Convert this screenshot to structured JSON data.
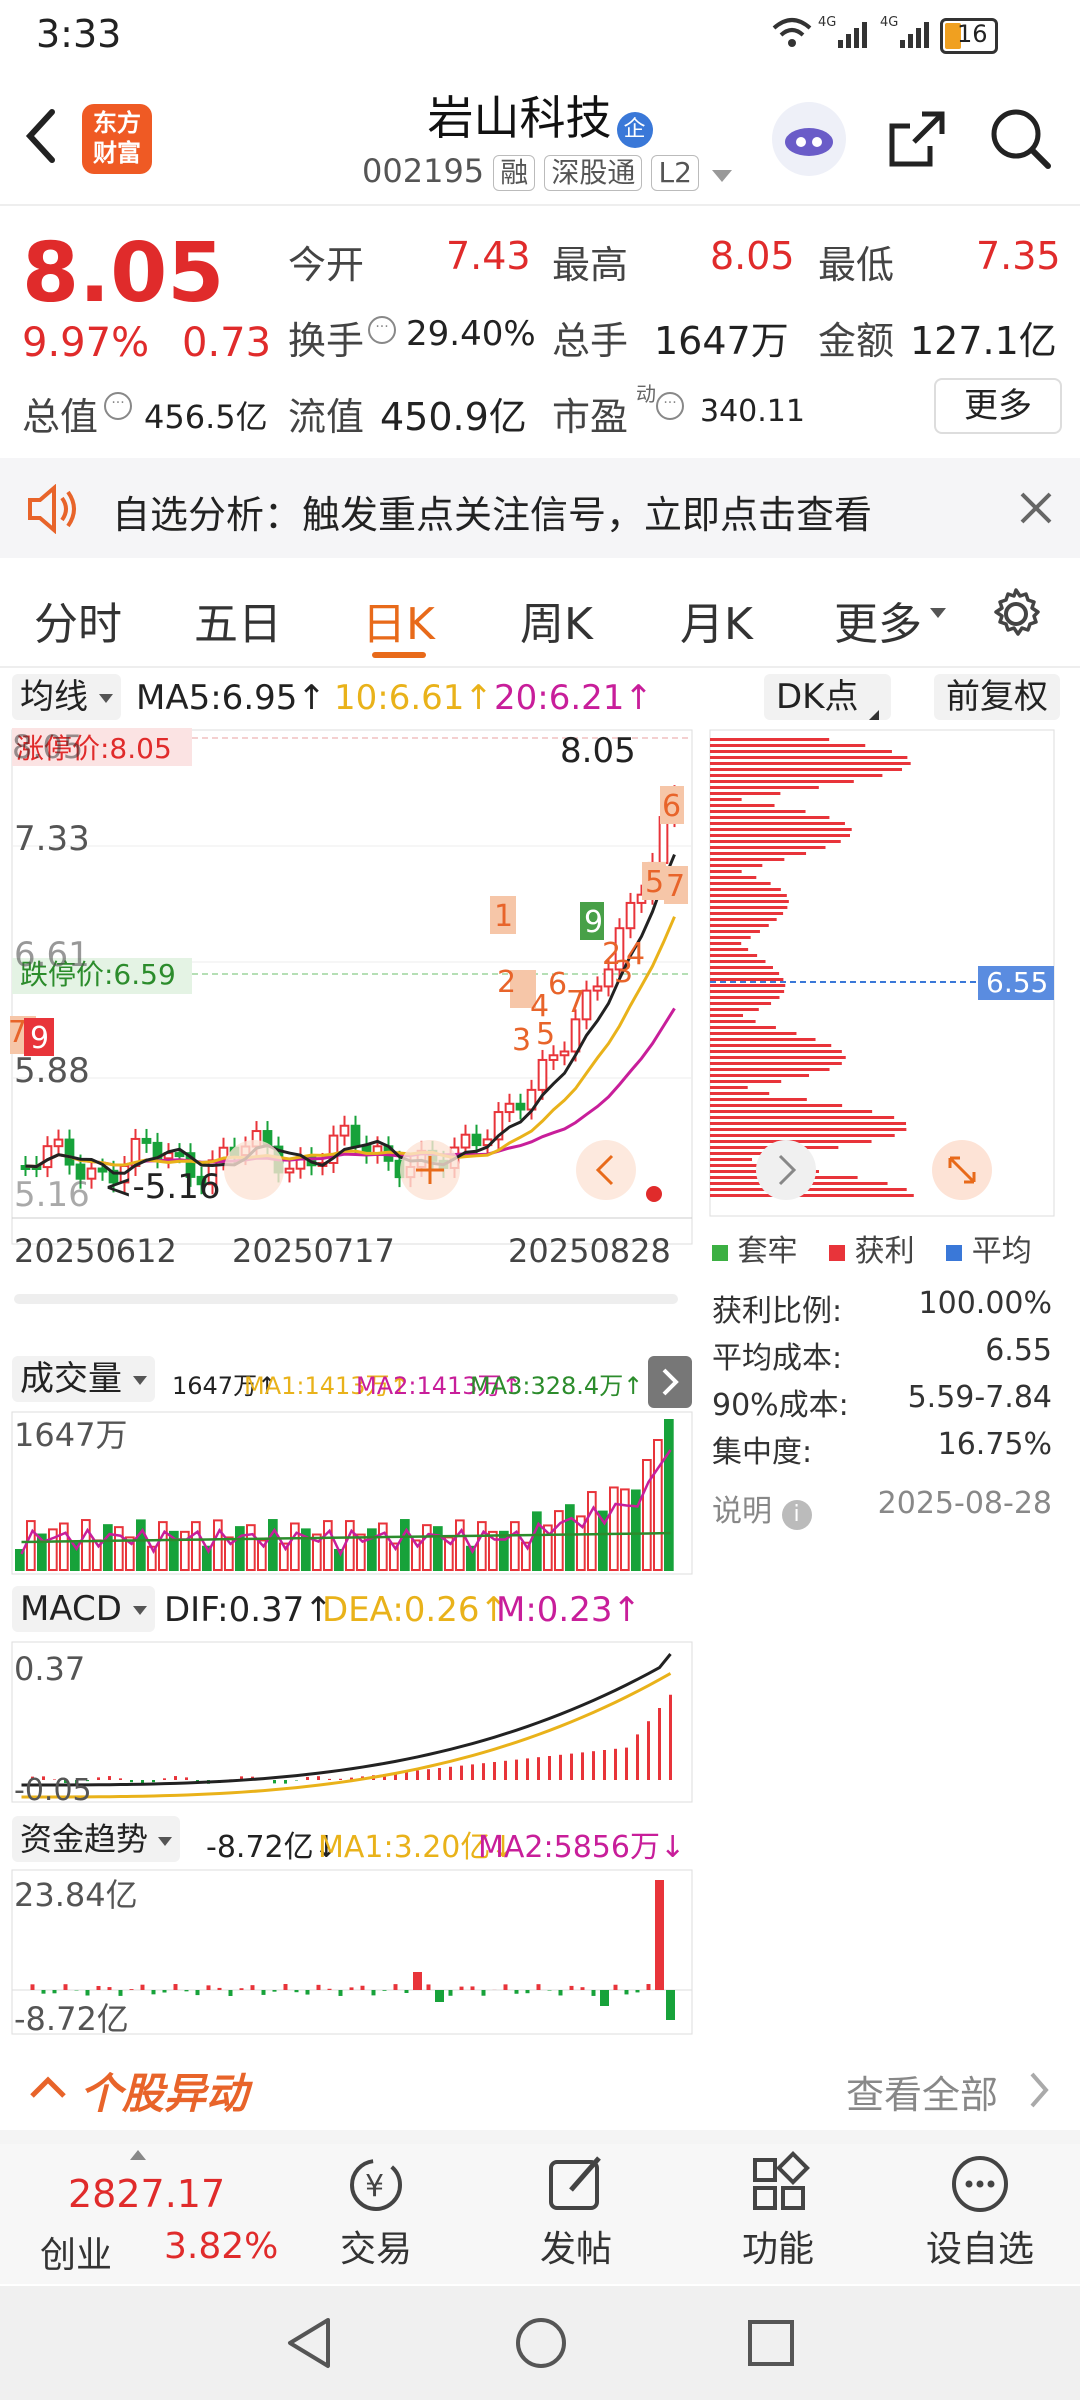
{
  "status_bar": {
    "time": "3:33",
    "network": "4G",
    "battery": "16"
  },
  "header": {
    "logo_line1": "东方",
    "logo_line2": "财富",
    "stock_name": "岩山科技",
    "name_badge": "企",
    "stock_code": "002195",
    "tags": [
      "融",
      "深股通",
      "L2"
    ]
  },
  "quote": {
    "price": "8.05",
    "change_pct": "9.97%",
    "change": "0.73",
    "open_label": "今开",
    "open": "7.43",
    "high_label": "最高",
    "high": "8.05",
    "low_label": "最低",
    "low": "7.35",
    "turnover_label": "换手",
    "turnover": "29.40%",
    "volume_label": "总手",
    "volume": "1647万",
    "amount_label": "金额",
    "amount": "127.1亿",
    "mktcap_label": "总值",
    "mktcap": "456.5亿",
    "float_label": "流值",
    "float_cap": "450.9亿",
    "pe_label": "市盈",
    "pe_sup": "动",
    "pe": "340.11",
    "more_button": "更多"
  },
  "alert": {
    "text": "自选分析：触发重点关注信号，立即点击查看"
  },
  "tabs": [
    "分时",
    "五日",
    "日K",
    "周K",
    "月K",
    "更多"
  ],
  "active_tab": "日K",
  "kline": {
    "ma_selector": "均线",
    "ma5": "MA5:6.95↑",
    "ma10": "10:6.61↑",
    "ma20": "20:6.21↑",
    "dk_button": "DK点",
    "adjust_button": "前复权",
    "limit_up": "涨停价:8.05",
    "limit_down": "跌停价:6.59",
    "price_top": "8.05",
    "price_label_top": "8.05",
    "y_labels": [
      "7.33",
      "6.61",
      "5.88",
      "5.16"
    ],
    "low_marker": "<-5.16",
    "dates": [
      "20250612",
      "20250717",
      "20250828"
    ],
    "chip_price": "6.55",
    "colors": {
      "up": "#e8343a",
      "down": "#17a23a",
      "ma5": "#222222",
      "ma10": "#e9b21a",
      "ma20": "#c81e9a"
    }
  },
  "chips": {
    "legend": [
      "套牢",
      "获利",
      "平均"
    ],
    "rows": [
      {
        "label": "获利比例:",
        "value": "100.00%"
      },
      {
        "label": "平均成本:",
        "value": "6.55"
      },
      {
        "label": "90%成本:",
        "value": "5.59-7.84"
      },
      {
        "label": "集中度:",
        "value": "16.75%"
      }
    ],
    "note_label": "说明",
    "date": "2025-08-28"
  },
  "volume": {
    "selector": "成交量",
    "vol": "1647万↑",
    "ma1": "MA1:1413万↑",
    "ma2": "MA2:1413万↑",
    "ma3": "MA3:328.4万↑",
    "max_label": "1647万"
  },
  "macd": {
    "selector": "MACD",
    "dif": "DIF:0.37↑",
    "dea": "DEA:0.26↑",
    "m": "M:0.23↑",
    "top": "0.37",
    "bottom": "-0.05"
  },
  "fund": {
    "selector": "资金趋势",
    "value": "-8.72亿↓",
    "ma1": "MA1:3.20亿↓",
    "ma2": "MA2:5856万↓",
    "top": "23.84亿",
    "bottom": "-8.72亿"
  },
  "movement": {
    "title": "个股异动",
    "view_all": "查看全部"
  },
  "bottom_nav": {
    "index_value": "2827.17",
    "index_name": "创业",
    "index_pct": "3.82%",
    "items": [
      "交易",
      "发帖",
      "功能",
      "设自选"
    ]
  }
}
